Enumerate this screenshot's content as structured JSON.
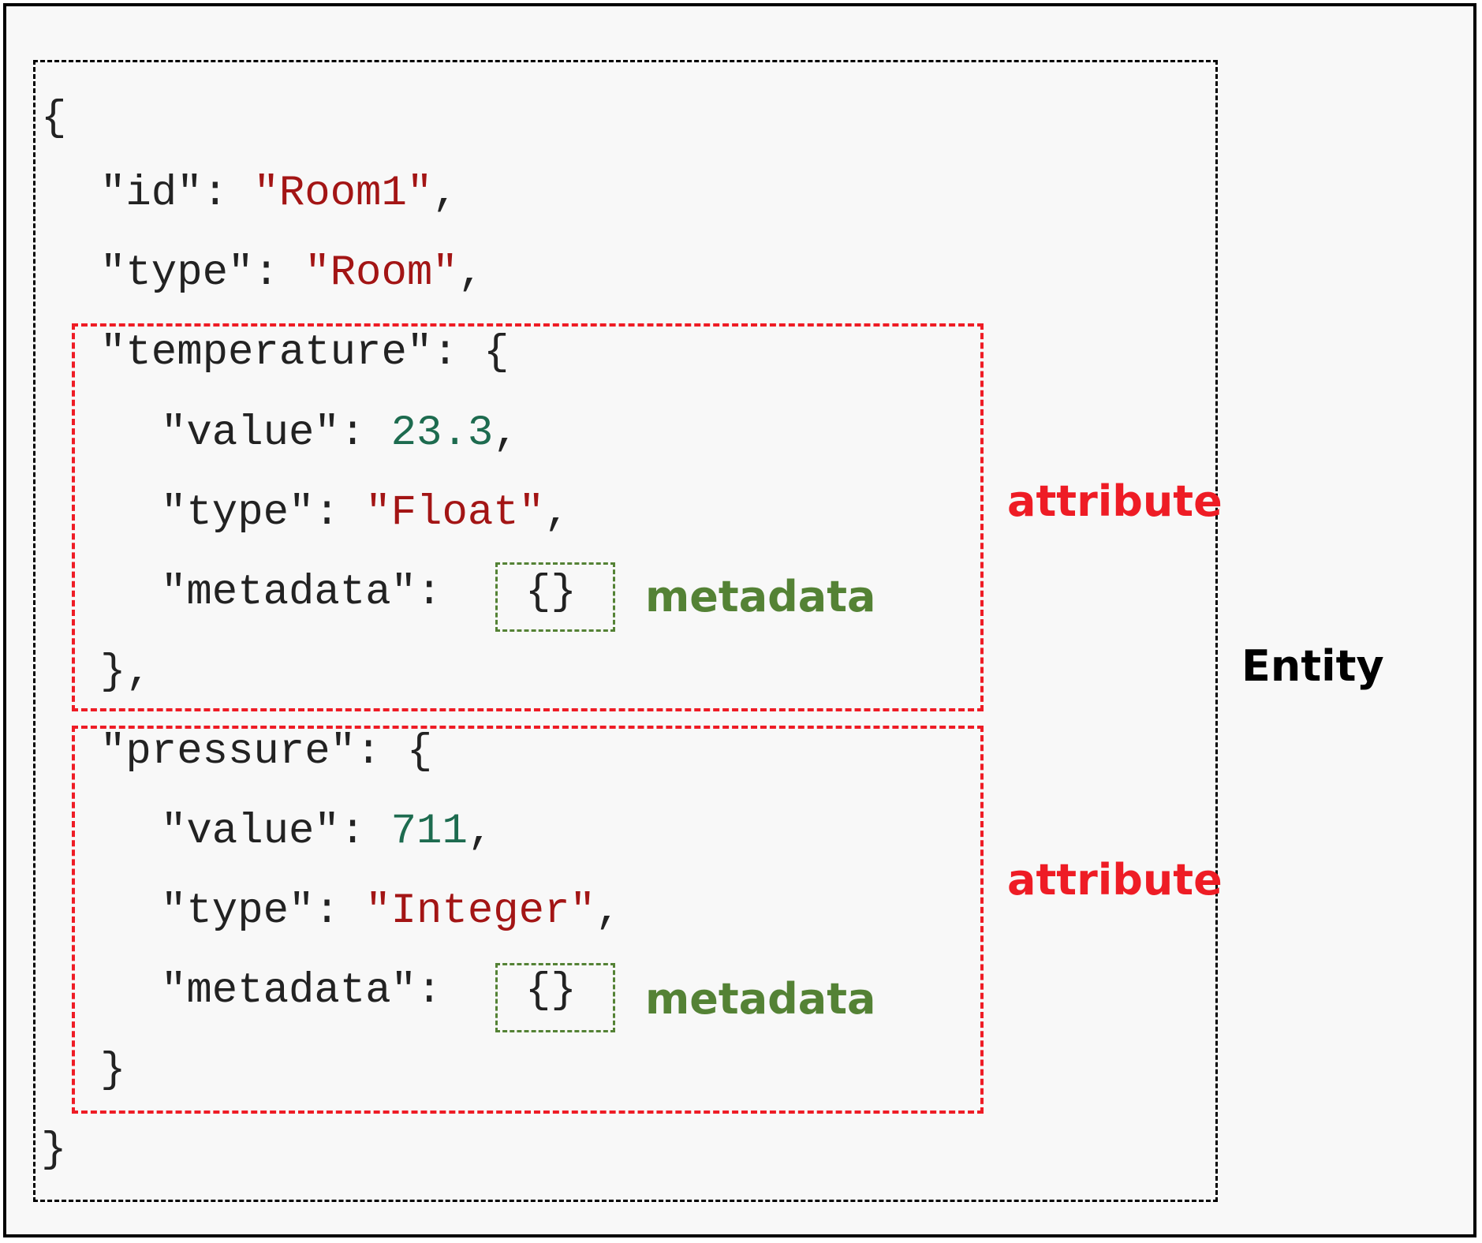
{
  "code": {
    "open_brace": "{",
    "id_key": "\"id\": ",
    "id_value": "\"Room1\"",
    "id_end": ",",
    "type_key": "\"type\": ",
    "type_value": "\"Room\"",
    "type_end": ",",
    "temperature": {
      "key": "\"temperature\": {",
      "value_key": "\"value\": ",
      "value": "23.3",
      "value_end": ",",
      "type_key": "\"type\": ",
      "type_value": "\"Float\"",
      "type_end": ",",
      "metadata_key": "\"metadata\": ",
      "metadata_value": "{}",
      "close": "},"
    },
    "pressure": {
      "key": "\"pressure\": {",
      "value_key": "\"value\": ",
      "value": "711",
      "value_end": ",",
      "type_key": "\"type\": ",
      "type_value": "\"Integer\"",
      "type_end": ",",
      "metadata_key": "\"metadata\": ",
      "metadata_value": "{}",
      "close": "}"
    },
    "close_brace": "}"
  },
  "labels": {
    "attribute_1": "attribute",
    "metadata_1": "metadata",
    "attribute_2": "attribute",
    "metadata_2": "metadata",
    "entity": "Entity"
  },
  "colors": {
    "entity_border": "#000000",
    "attribute": "#ee1c25",
    "metadata": "#548235",
    "json_string": "#a31515",
    "json_number": "#1d6b4f",
    "json_text": "#222222",
    "background": "#f8f8f8"
  }
}
